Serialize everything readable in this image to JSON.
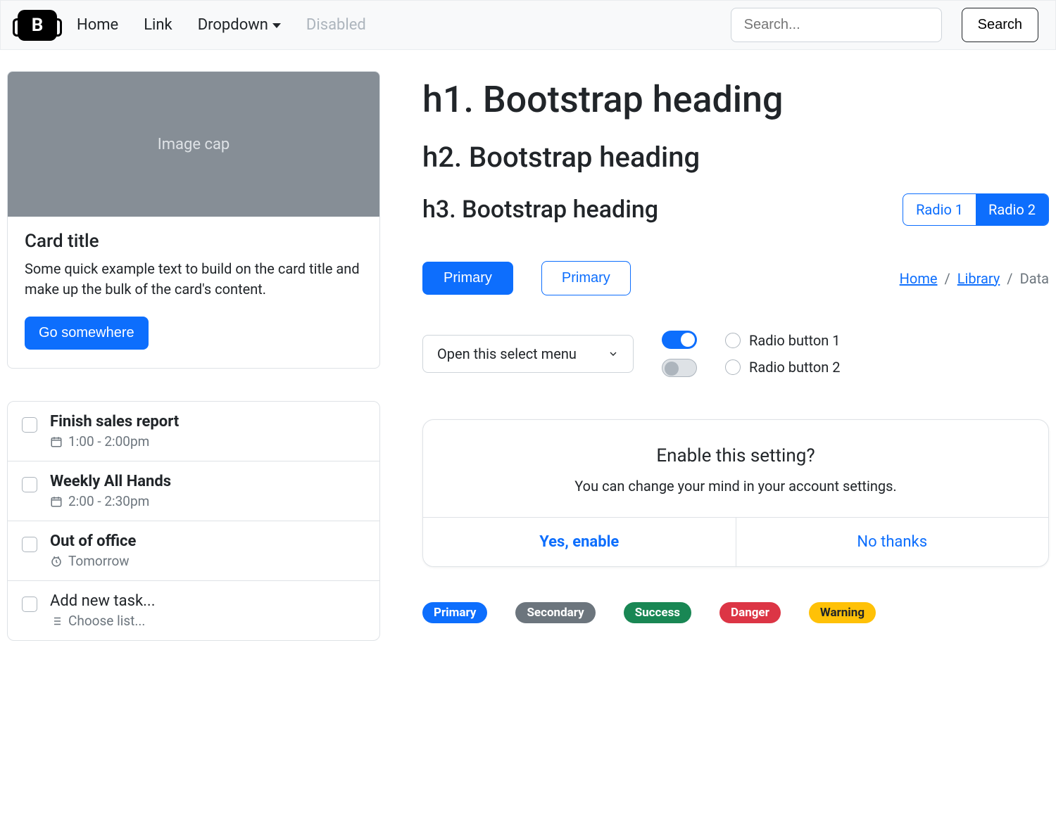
{
  "nav": {
    "brand": "B",
    "links": {
      "home": "Home",
      "link": "Link",
      "dropdown": "Dropdown",
      "disabled": "Disabled"
    },
    "search_placeholder": "Search...",
    "search_button": "Search"
  },
  "card": {
    "image_label": "Image cap",
    "title": "Card title",
    "text": "Some quick example text to build on the card title and make up the bulk of the card's content.",
    "button": "Go somewhere"
  },
  "tasks": {
    "items": [
      {
        "title": "Finish sales report",
        "sub": "1:00 - 2:00pm",
        "icon": "calendar"
      },
      {
        "title": "Weekly All Hands",
        "sub": "2:00 - 2:30pm",
        "icon": "calendar"
      },
      {
        "title": "Out of office",
        "sub": "Tomorrow",
        "icon": "clock"
      },
      {
        "title": "Add new task...",
        "sub": "Choose list...",
        "icon": "list",
        "muted": true
      }
    ]
  },
  "headings": {
    "h1": "h1. Bootstrap heading",
    "h2": "h2. Bootstrap heading",
    "h3": "h3. Bootstrap heading"
  },
  "radio_toggle": {
    "opt1": "Radio 1",
    "opt2": "Radio 2"
  },
  "buttons": {
    "primary_fill": "Primary",
    "primary_outline": "Primary"
  },
  "breadcrumb": {
    "home": "Home",
    "library": "Library",
    "data": "Data"
  },
  "select": {
    "label": "Open this select menu"
  },
  "radios": {
    "r1": "Radio button 1",
    "r2": "Radio button 2"
  },
  "dialog": {
    "title": "Enable this setting?",
    "text": "You can change your mind in your account settings.",
    "yes": "Yes, enable",
    "no": "No thanks"
  },
  "badges": {
    "primary": "Primary",
    "secondary": "Secondary",
    "success": "Success",
    "danger": "Danger",
    "warning": "Warning"
  }
}
